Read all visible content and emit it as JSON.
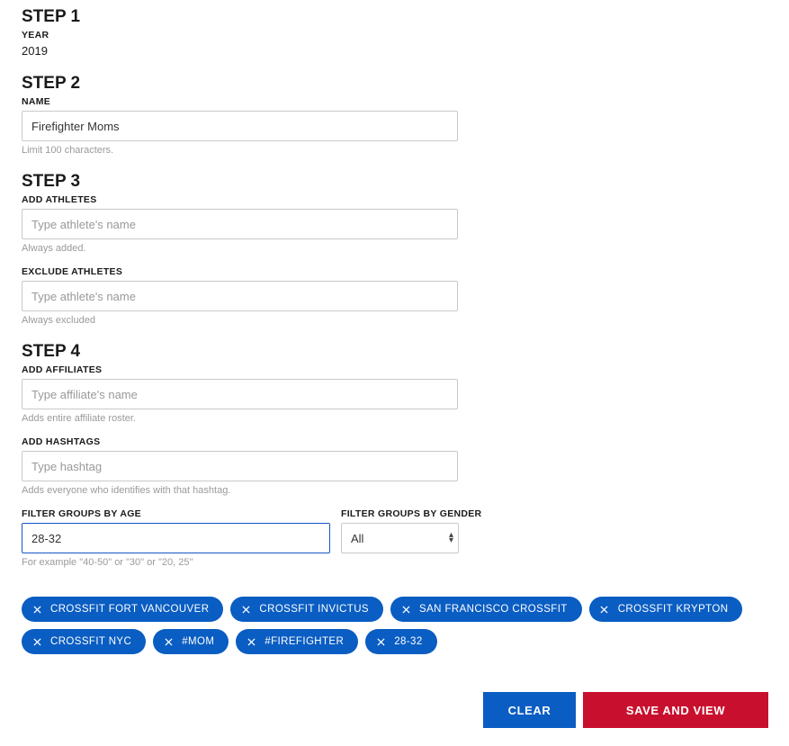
{
  "step1": {
    "heading": "STEP 1",
    "year_label": "YEAR",
    "year_value": "2019"
  },
  "step2": {
    "heading": "STEP 2",
    "name_label": "NAME",
    "name_value": "Firefighter Moms",
    "name_helper": "Limit 100 characters."
  },
  "step3": {
    "heading": "STEP 3",
    "add_athletes_label": "ADD ATHLETES",
    "add_athletes_placeholder": "Type athlete's name",
    "add_athletes_helper": "Always added.",
    "exclude_athletes_label": "EXCLUDE ATHLETES",
    "exclude_athletes_placeholder": "Type athlete's name",
    "exclude_athletes_helper": "Always excluded"
  },
  "step4": {
    "heading": "STEP 4",
    "add_affiliates_label": "ADD AFFILIATES",
    "add_affiliates_placeholder": "Type affiliate's name",
    "add_affiliates_helper": "Adds entire affiliate roster.",
    "add_hashtags_label": "ADD HASHTAGS",
    "add_hashtags_placeholder": "Type hashtag",
    "add_hashtags_helper": "Adds everyone who identifies with that hashtag.",
    "filter_age_label": "FILTER GROUPS BY AGE",
    "filter_age_value": "28-32",
    "filter_age_helper": "For example \"40-50\" or \"30\" or \"20, 25\"",
    "filter_gender_label": "FILTER GROUPS BY GENDER",
    "filter_gender_value": "All"
  },
  "chips": [
    "CROSSFIT FORT VANCOUVER",
    "CROSSFIT INVICTUS",
    "SAN FRANCISCO CROSSFIT",
    "CROSSFIT KRYPTON",
    "CROSSFIT NYC",
    "#MOM",
    "#FIREFIGHTER",
    "28-32"
  ],
  "buttons": {
    "clear": "CLEAR",
    "save": "SAVE AND VIEW"
  }
}
